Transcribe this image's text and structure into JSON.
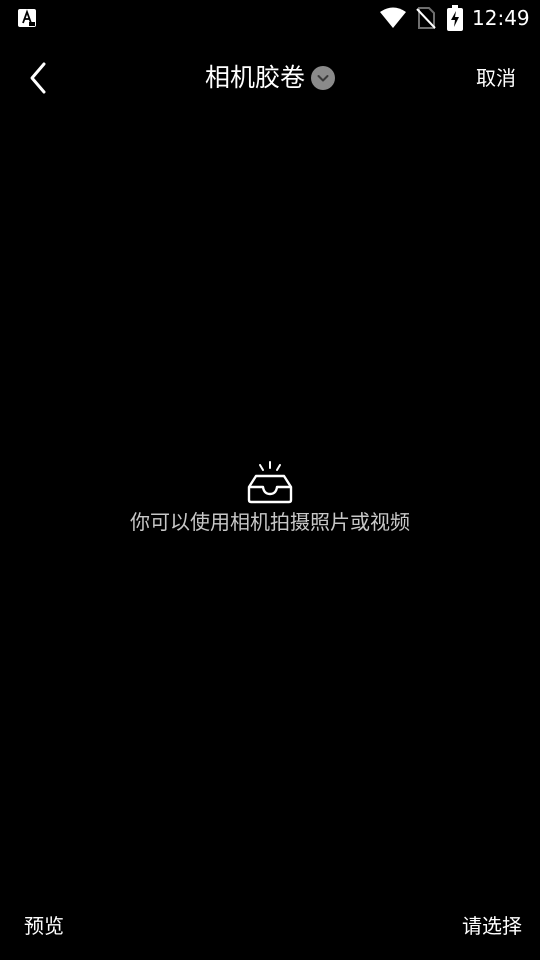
{
  "status_bar": {
    "time": "12:49",
    "left_icon": "font-a-icon",
    "wifi_icon": "wifi-icon",
    "sim_icon": "no-sim-icon",
    "battery_icon": "battery-charging-icon"
  },
  "header": {
    "back_icon": "chevron-left-icon",
    "title": "相机胶卷",
    "title_dropdown_icon": "chevron-down-circle-icon",
    "cancel_label": "取消"
  },
  "empty_state": {
    "icon": "empty-inbox-icon",
    "message": "你可以使用相机拍摄照片或视频"
  },
  "footer": {
    "preview_label": "预览",
    "select_label": "请选择"
  },
  "colors": {
    "background": "#000000",
    "text": "#ffffff",
    "muted_text": "#c8c8c8",
    "dropdown_badge": "#8a8a8a"
  }
}
